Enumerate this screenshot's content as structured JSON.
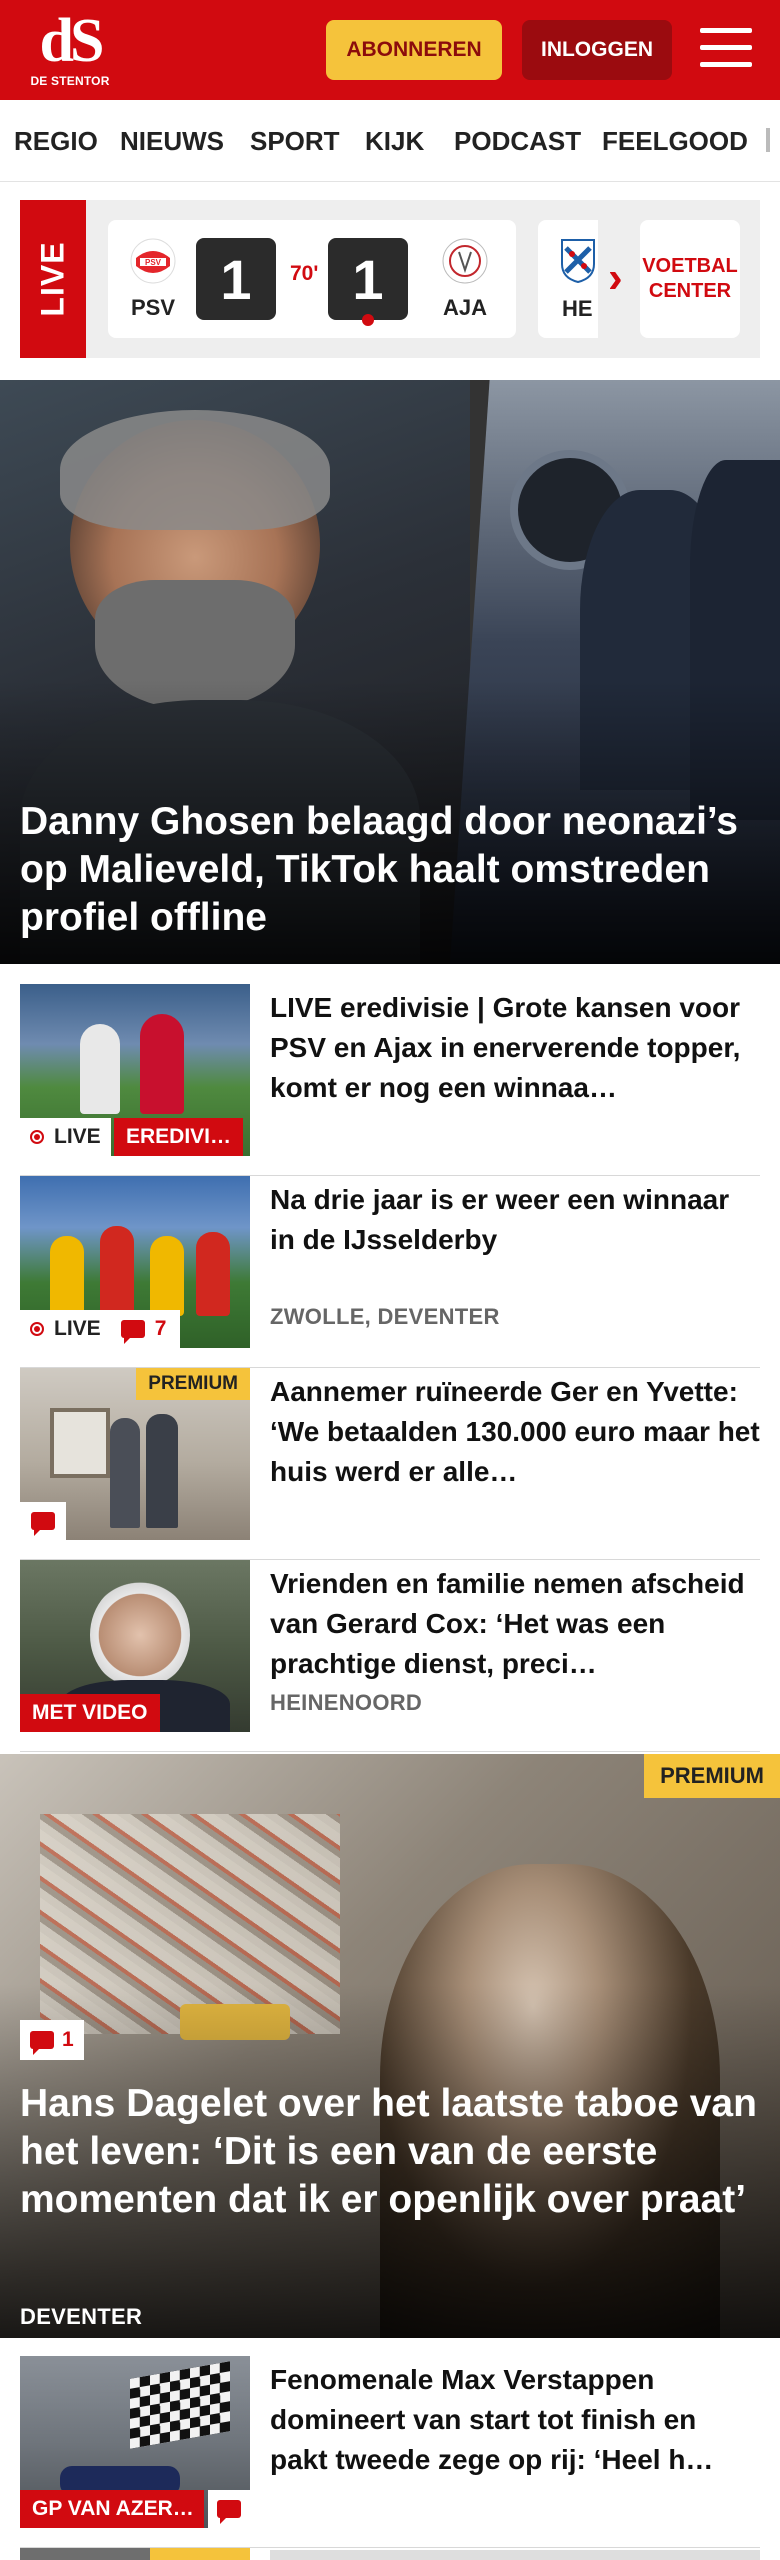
{
  "header": {
    "logo_mark": "dS",
    "logo_text": "DE STENTOR",
    "subscribe_label": "ABONNEREN",
    "login_label": "INLOGGEN",
    "menu_icon": "hamburger-menu-icon",
    "brand_color": "#d10a10",
    "accent_color": "#f5c33b"
  },
  "nav": {
    "items": [
      "REGIO",
      "NIEUWS",
      "SPORT",
      "KIJK",
      "PODCAST",
      "FEELGOOD"
    ]
  },
  "live_bar": {
    "live_label": "LIVE",
    "match": {
      "home_team": "PSV",
      "away_team": "AJA",
      "home_score": "1",
      "away_score": "1",
      "minute": "70'"
    },
    "next_team": "HE",
    "more_label": "VOETBAL CENTER"
  },
  "hero": {
    "title": "Danny Ghosen belaagd door neonazi’s op Malieveld, TikTok haalt omstreden profiel offline"
  },
  "articles": [
    {
      "title": "LIVE eredivisie | Grote kansen voor PSV en Ajax in enerverende topper, komt er nog een winnaa…",
      "live_label": "LIVE",
      "category": "EREDIVI…"
    },
    {
      "title": "Na drie jaar is er weer een winnaar in de IJsselderby",
      "location": "ZWOLLE, DEVENTER",
      "live_label": "LIVE",
      "comment_count": "7"
    },
    {
      "title": "Aannemer ruïneerde Ger en Yvette: ‘We betaalden 130.000 euro maar het huis werd er alle…",
      "premium_label": "PREMIUM"
    },
    {
      "title": "Vrienden en familie nemen afscheid van Gerard Cox: ‘Het was een prachtige dienst, preci…",
      "location": "HEINENOORD",
      "video_label": "MET VIDEO"
    }
  ],
  "feature": {
    "premium_label": "PREMIUM",
    "comment_count": "1",
    "title": "Hans Dagelet over het laatste taboe van het leven: ‘Dit is een van de eerste momenten dat ik er openlijk over praat’",
    "location": "DEVENTER"
  },
  "article_after": {
    "title": "Fenomenale Max Verstappen domineert van start tot finish en pakt tweede zege op rij: ‘Heel h…",
    "category": "GP VAN AZER…"
  }
}
